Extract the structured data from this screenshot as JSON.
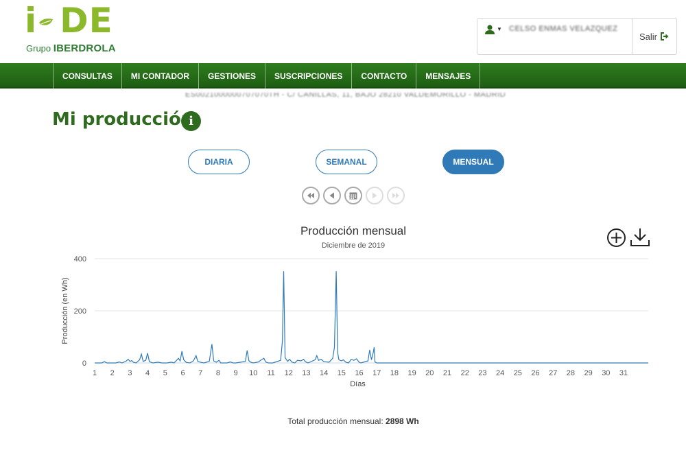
{
  "brand": {
    "logo_text": "i-DE",
    "group_prefix": "Grupo",
    "group_name": "IBERDROLA"
  },
  "user_menu": {
    "user_name": "CELSO ENMAS VELAZQUEZ",
    "logout_label": "Salir"
  },
  "nav": {
    "items": [
      {
        "label": "CONSULTAS"
      },
      {
        "label": "MI CONTADOR"
      },
      {
        "label": "GESTIONES"
      },
      {
        "label": "SUSCRIPCIONES"
      },
      {
        "label": "CONTACTO"
      },
      {
        "label": "MENSAJES"
      }
    ]
  },
  "supply_address": "ES0021000000707070TH - C/ CANILLAS, 11, BAJO 28210 VALDEMORILLO - MADRID",
  "page": {
    "title": "Mi producción"
  },
  "period": {
    "daily": "DIARIA",
    "weekly": "SEMANAL",
    "monthly": "MENSUAL",
    "selected": "monthly"
  },
  "colors": {
    "brand_green": "#2e6b1e",
    "nav_green": "#2f7d1f",
    "accent_blue": "#2f7ab7",
    "series_color": "#2f7ab7"
  },
  "icons": {
    "first": "double-chevron-left-icon",
    "prev": "triangle-left-icon",
    "calendar": "calendar-icon",
    "next": "triangle-right-icon",
    "last": "double-chevron-right-icon",
    "zoom": "circle-plus-icon",
    "download": "download-icon"
  },
  "chart_data": {
    "type": "line",
    "title": "Producción mensual",
    "subtitle": "Diciembre de 2019",
    "xlabel": "Días",
    "ylabel": "Producción (en Wh)",
    "ylim": [
      0,
      400
    ],
    "yticks": [
      0,
      200,
      400
    ],
    "xlim": [
      1,
      32.4
    ],
    "xticks": [
      1,
      2,
      3,
      4,
      5,
      6,
      7,
      8,
      9,
      10,
      11,
      12,
      13,
      14,
      15,
      16,
      17,
      18,
      19,
      20,
      21,
      22,
      23,
      24,
      25,
      26,
      27,
      28,
      29,
      30,
      31
    ],
    "grid": "horizontal",
    "series": [
      {
        "points": [
          [
            1.0,
            0
          ],
          [
            1.4,
            0
          ],
          [
            1.55,
            5
          ],
          [
            1.7,
            0
          ],
          [
            2.2,
            0
          ],
          [
            2.4,
            4
          ],
          [
            2.55,
            0
          ],
          [
            2.8,
            8
          ],
          [
            2.9,
            14
          ],
          [
            3.0,
            6
          ],
          [
            3.1,
            9
          ],
          [
            3.2,
            3
          ],
          [
            3.35,
            0
          ],
          [
            3.55,
            12
          ],
          [
            3.65,
            34
          ],
          [
            3.75,
            6
          ],
          [
            3.9,
            10
          ],
          [
            4.0,
            38
          ],
          [
            4.1,
            5
          ],
          [
            4.3,
            0
          ],
          [
            4.6,
            3
          ],
          [
            4.8,
            0
          ],
          [
            5.1,
            0
          ],
          [
            5.35,
            3
          ],
          [
            5.5,
            0
          ],
          [
            5.65,
            10
          ],
          [
            5.75,
            18
          ],
          [
            5.85,
            8
          ],
          [
            5.95,
            45
          ],
          [
            6.05,
            12
          ],
          [
            6.2,
            2
          ],
          [
            6.4,
            0
          ],
          [
            6.6,
            8
          ],
          [
            6.75,
            28
          ],
          [
            6.85,
            6
          ],
          [
            7.0,
            3
          ],
          [
            7.2,
            0
          ],
          [
            7.5,
            6
          ],
          [
            7.65,
            72
          ],
          [
            7.75,
            8
          ],
          [
            7.9,
            3
          ],
          [
            8.05,
            10
          ],
          [
            8.15,
            0
          ],
          [
            8.5,
            0
          ],
          [
            8.7,
            4
          ],
          [
            8.85,
            0
          ],
          [
            9.0,
            0
          ],
          [
            9.55,
            6
          ],
          [
            9.65,
            48
          ],
          [
            9.75,
            8
          ],
          [
            9.85,
            3
          ],
          [
            10.0,
            0
          ],
          [
            10.3,
            4
          ],
          [
            10.45,
            12
          ],
          [
            10.6,
            18
          ],
          [
            10.7,
            4
          ],
          [
            10.85,
            0
          ],
          [
            11.1,
            0
          ],
          [
            11.55,
            10
          ],
          [
            11.65,
            85
          ],
          [
            11.72,
            352
          ],
          [
            11.8,
            20
          ],
          [
            11.95,
            6
          ],
          [
            12.05,
            14
          ],
          [
            12.2,
            3
          ],
          [
            12.35,
            0
          ],
          [
            12.5,
            10
          ],
          [
            12.7,
            8
          ],
          [
            12.85,
            14
          ],
          [
            12.95,
            5
          ],
          [
            13.1,
            0
          ],
          [
            13.5,
            12
          ],
          [
            13.6,
            28
          ],
          [
            13.7,
            10
          ],
          [
            13.85,
            14
          ],
          [
            14.0,
            5
          ],
          [
            14.3,
            3
          ],
          [
            14.5,
            18
          ],
          [
            14.6,
            60
          ],
          [
            14.7,
            352
          ],
          [
            14.78,
            40
          ],
          [
            14.85,
            12
          ],
          [
            15.0,
            8
          ],
          [
            15.1,
            12
          ],
          [
            15.25,
            3
          ],
          [
            15.4,
            0
          ],
          [
            15.55,
            14
          ],
          [
            15.7,
            10
          ],
          [
            15.85,
            16
          ],
          [
            16.0,
            3
          ],
          [
            16.1,
            0
          ],
          [
            16.5,
            8
          ],
          [
            16.6,
            50
          ],
          [
            16.7,
            12
          ],
          [
            16.8,
            40
          ],
          [
            16.85,
            60
          ],
          [
            16.9,
            4
          ],
          [
            17.0,
            0
          ],
          [
            20.0,
            0
          ],
          [
            25.0,
            0
          ],
          [
            30.0,
            0
          ],
          [
            32.4,
            0
          ]
        ]
      }
    ]
  },
  "total": {
    "label": "Total producción mensual:",
    "value": "2898 Wh"
  }
}
